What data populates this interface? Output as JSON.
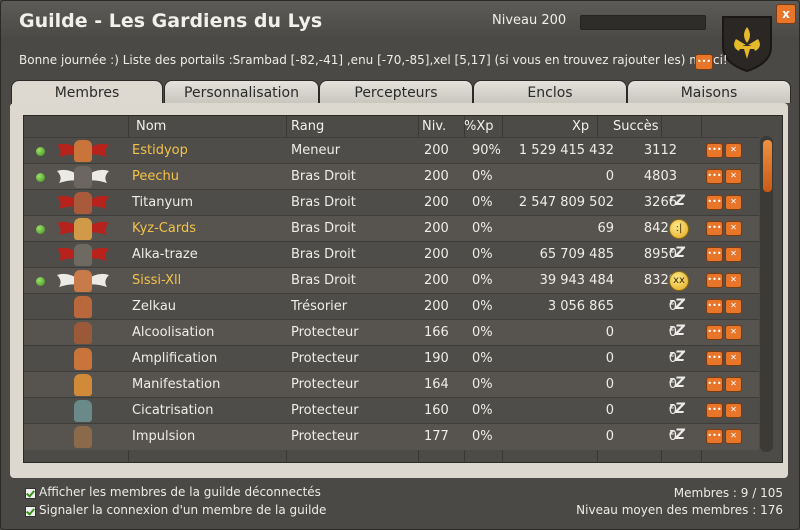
{
  "window": {
    "title": "Guilde - Les Gardiens du Lys",
    "level_label": "Niveau 200",
    "close_label": "x"
  },
  "motd": {
    "text": "Bonne journée :) Liste des portails :Srambad [-82,-41] ,enu [-70,-85],xel [5,17] (si vous en trouvez rajouter les) merci!"
  },
  "tabs": [
    {
      "label": "Membres"
    },
    {
      "label": "Personnalisation"
    },
    {
      "label": "Percepteurs"
    },
    {
      "label": "Enclos"
    },
    {
      "label": "Maisons"
    }
  ],
  "table": {
    "headers": {
      "nom": "Nom",
      "rang": "Rang",
      "niv": "Niv.",
      "pctxp": "%Xp",
      "xp": "Xp",
      "succes": "Succès"
    },
    "rows": [
      {
        "online": true,
        "name": "Estidyop",
        "rank": "Meneur",
        "niv": "200",
        "pct": "90%",
        "xp": "1 529 415 432",
        "succ": "3112",
        "status": "",
        "wings": "red",
        "highlight": true
      },
      {
        "online": true,
        "name": "Peechu",
        "rank": "Bras Droit",
        "niv": "200",
        "pct": "0%",
        "xp": "0",
        "succ": "4803",
        "status": "",
        "wings": "white",
        "highlight": true
      },
      {
        "online": false,
        "name": "Titanyum",
        "rank": "Bras Droit",
        "niv": "200",
        "pct": "0%",
        "xp": "2 547 809 502",
        "succ": "3266",
        "status": "zz",
        "wings": "red",
        "highlight": false
      },
      {
        "online": true,
        "name": "Kyz-Cards",
        "rank": "Bras Droit",
        "niv": "200",
        "pct": "0%",
        "xp": "69",
        "succ": "8424",
        "status": "sad",
        "wings": "red",
        "highlight": true
      },
      {
        "online": false,
        "name": "Alka-traze",
        "rank": "Bras Droit",
        "niv": "200",
        "pct": "0%",
        "xp": "65 709 485",
        "succ": "8950",
        "status": "zz",
        "wings": "red",
        "highlight": false
      },
      {
        "online": true,
        "name": "Sissi-Xll",
        "rank": "Bras Droit",
        "niv": "200",
        "pct": "0%",
        "xp": "39 943 484",
        "succ": "8329",
        "status": "x",
        "wings": "white",
        "highlight": true
      },
      {
        "online": false,
        "name": "Zelkau",
        "rank": "Trésorier",
        "niv": "200",
        "pct": "0%",
        "xp": "3 056 865",
        "succ": "0",
        "status": "zz",
        "wings": "",
        "highlight": false
      },
      {
        "online": false,
        "name": "Alcoolisation",
        "rank": "Protecteur",
        "niv": "166",
        "pct": "0%",
        "xp": "0",
        "succ": "0",
        "status": "zz",
        "wings": "",
        "highlight": false
      },
      {
        "online": false,
        "name": "Amplification",
        "rank": "Protecteur",
        "niv": "190",
        "pct": "0%",
        "xp": "0",
        "succ": "0",
        "status": "zz",
        "wings": "",
        "highlight": false
      },
      {
        "online": false,
        "name": "Manifestation",
        "rank": "Protecteur",
        "niv": "164",
        "pct": "0%",
        "xp": "0",
        "succ": "0",
        "status": "zz",
        "wings": "",
        "highlight": false
      },
      {
        "online": false,
        "name": "Cicatrisation",
        "rank": "Protecteur",
        "niv": "160",
        "pct": "0%",
        "xp": "0",
        "succ": "0",
        "status": "zz",
        "wings": "",
        "highlight": false
      },
      {
        "online": false,
        "name": "Impulsion",
        "rank": "Protecteur",
        "niv": "177",
        "pct": "0%",
        "xp": "0",
        "succ": "0",
        "status": "zz",
        "wings": "",
        "highlight": false
      }
    ]
  },
  "footer": {
    "show_offline": "Afficher les membres de la guilde déconnectés",
    "notify_login": "Signaler la connexion d'un membre de la guilde",
    "members_count": "Membres : 9 / 105",
    "avg_level": "Niveau moyen des membres : 176"
  },
  "colors": {
    "accent": "#e8762a",
    "highlight_name": "#f3c24a",
    "online": "#5fbf2a"
  }
}
